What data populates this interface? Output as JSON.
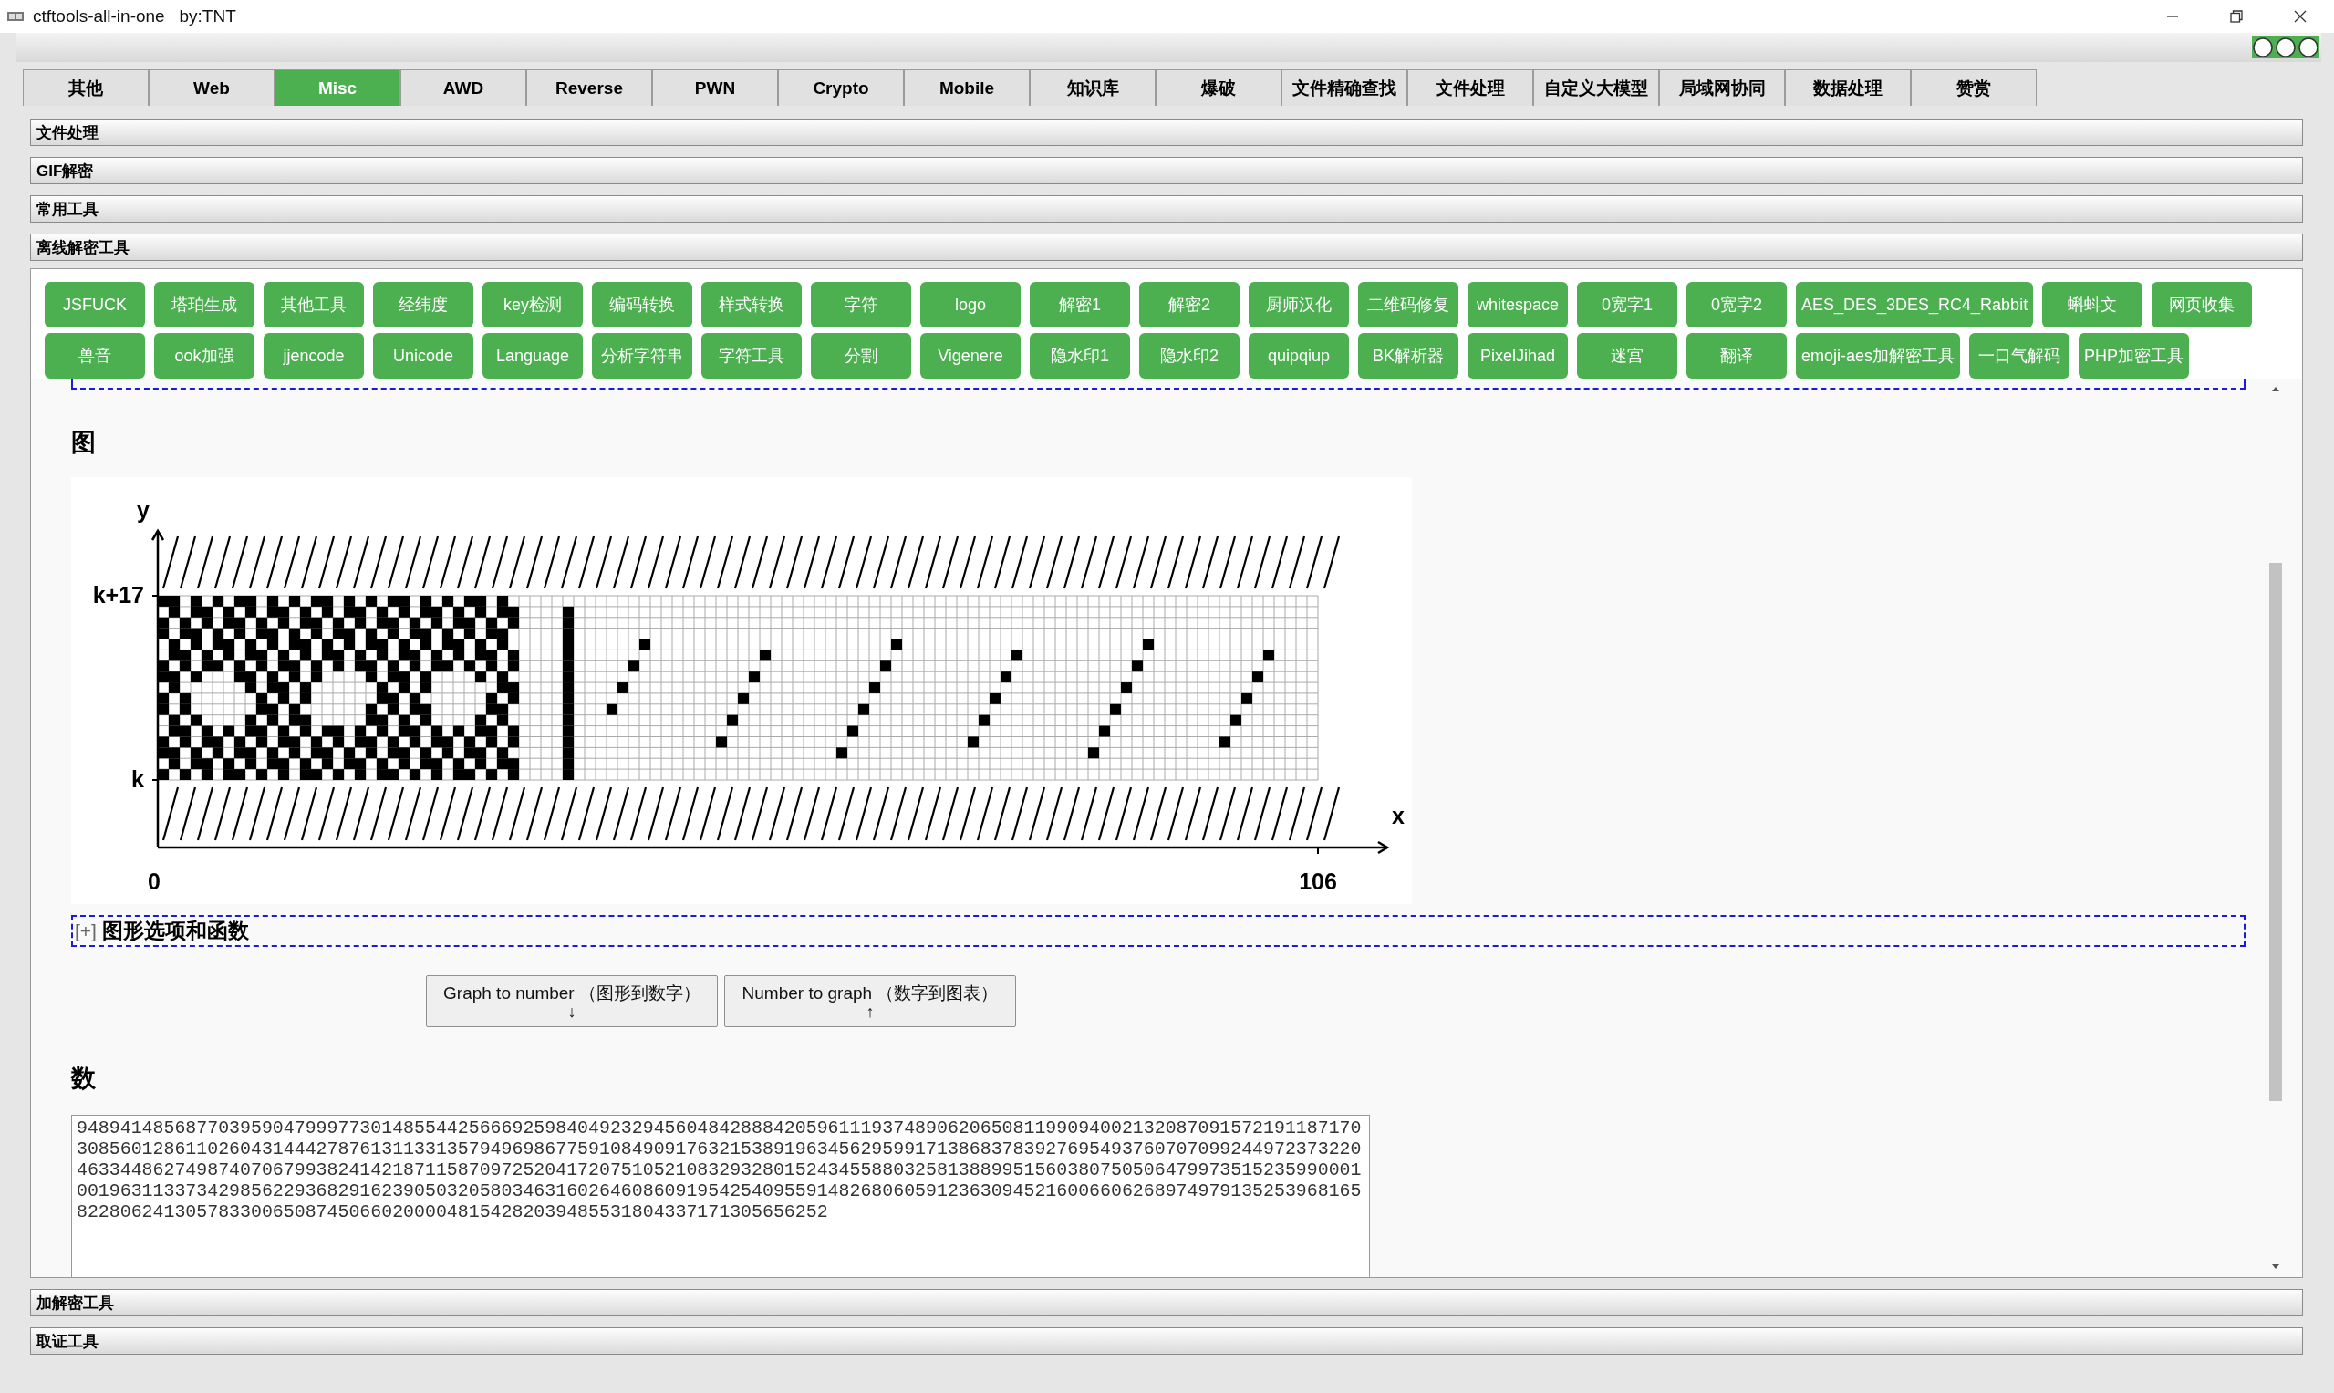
{
  "window": {
    "title": "ctftools-all-in-one   by:TNT"
  },
  "tabs": [
    {
      "label": "其他",
      "selected": false
    },
    {
      "label": "Web",
      "selected": false
    },
    {
      "label": "Misc",
      "selected": true
    },
    {
      "label": "AWD",
      "selected": false
    },
    {
      "label": "Reverse",
      "selected": false
    },
    {
      "label": "PWN",
      "selected": false
    },
    {
      "label": "Crypto",
      "selected": false
    },
    {
      "label": "Mobile",
      "selected": false
    },
    {
      "label": "知识库",
      "selected": false
    },
    {
      "label": "爆破",
      "selected": false
    },
    {
      "label": "文件精确查找",
      "selected": false
    },
    {
      "label": "文件处理",
      "selected": false
    },
    {
      "label": "自定义大模型",
      "selected": false
    },
    {
      "label": "局域网协同",
      "selected": false
    },
    {
      "label": "数据处理",
      "selected": false
    },
    {
      "label": "赞赏",
      "selected": false
    }
  ],
  "sections_before": [
    "文件处理",
    "GIF解密",
    "常用工具"
  ],
  "open_section": {
    "label": "离线解密工具"
  },
  "sections_after": [
    "加解密工具",
    "取证工具"
  ],
  "tool_buttons": [
    [
      "JSFUCK",
      "塔珀生成",
      "其他工具",
      "经纬度",
      "key检测",
      "编码转换",
      "样式转换",
      "字符",
      "logo",
      "解密1",
      "解密2",
      "厨师汉化",
      "二维码修复",
      "whitespace",
      "0宽字1",
      "0宽字2",
      "AES_DES_3DES_RC4_Rabbit",
      "蝌蚪文",
      "网页收集"
    ],
    [
      "兽音",
      "ook加强",
      "jjencode",
      "Unicode",
      "Language",
      "分析字符串",
      "字符工具",
      "分割",
      "Vigenere",
      "隐水印1",
      "隐水印2",
      "quipqiup",
      "BK解析器",
      "PixelJihad",
      "迷宫",
      "翻译",
      "emoji-aes加解密工具",
      "一口气解码",
      "PHP加密工具"
    ]
  ],
  "page": {
    "graph_heading": "图",
    "graph": {
      "y_axis": "y",
      "x_axis": "x",
      "y_ticks": [
        "k+17",
        "k"
      ],
      "x_ticks": [
        "0",
        "106"
      ]
    },
    "options_section": {
      "toggle": "[+]",
      "label": "图形选项和函数"
    },
    "buttons": [
      {
        "label": "Graph to number （图形到数字）",
        "arrow": "↓"
      },
      {
        "label": "Number to graph （数字到图表）",
        "arrow": "↑"
      }
    ],
    "number_heading": "数",
    "number_value": "9489414856877039590479997730148554425666925984049232945604842888420596111937489062065081199094002132087091572191187170308560128611026043144427876131133135794969867759108490917632153891963456295991713868378392769549376070709924497237322046334486274987407067993824142187115870972520417207510521083293280152434558803258138899515603807505064799735152359900010019631133734298562293682916239050320580346316026460860919542540955914826806059123630945216006606268974979135253968165822806241305783300650874506602000048154282039485531804337171305656252"
  }
}
